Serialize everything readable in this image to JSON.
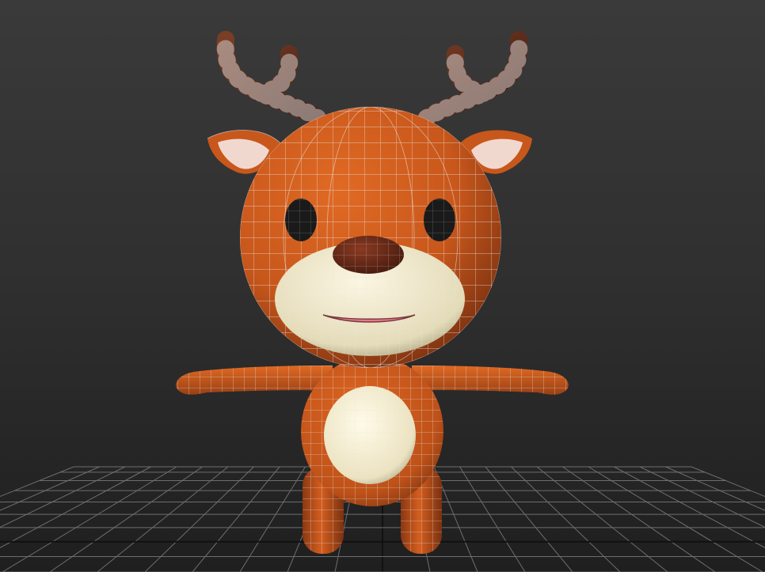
{
  "viewport": {
    "background_top": "#3a3a3a",
    "background_bottom": "#1f1f1f",
    "grid_color": "#6e6e6e",
    "grid_axis_color": "#111111",
    "wire_color": "#d8d8d8"
  },
  "model": {
    "name": "cartoon-deer",
    "body_color": "#c8571b",
    "body_shadow": "#7a3110",
    "antler_color": "#5a2a18",
    "belly_color": "#eee6c6",
    "inner_ear_color": "#f1d8cf",
    "nose_color": "#5c2415",
    "mouth_color": "#e5788a",
    "eye_color": "#1a1a1a"
  }
}
